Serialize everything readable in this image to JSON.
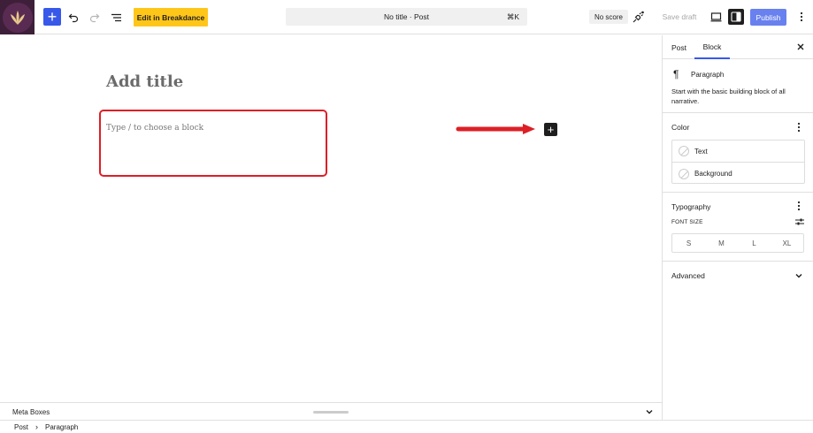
{
  "topbar": {
    "breakdance_label": "Edit in Breakdance",
    "command": {
      "title": "No title · Post",
      "shortcut": "⌘K"
    },
    "score_label": "No score",
    "save_draft_label": "Save draft",
    "publish_label": "Publish"
  },
  "editor": {
    "title_placeholder": "Add title",
    "paragraph_placeholder": "Type / to choose a block"
  },
  "sidebar": {
    "tabs": [
      {
        "label": "Post"
      },
      {
        "label": "Block"
      }
    ],
    "block_card": {
      "name": "Paragraph",
      "description": "Start with the basic building block of all narrative."
    },
    "color": {
      "title": "Color",
      "items": [
        {
          "label": "Text"
        },
        {
          "label": "Background"
        }
      ]
    },
    "typography": {
      "title": "Typography",
      "font_size_label": "FONT SIZE",
      "sizes": [
        "S",
        "M",
        "L",
        "XL"
      ]
    },
    "advanced": {
      "title": "Advanced"
    }
  },
  "metaboxes": {
    "label": "Meta Boxes"
  },
  "breadcrumb": {
    "items": [
      "Post",
      "Paragraph"
    ]
  },
  "colors": {
    "accent": "#3858e9",
    "breakdance": "#ffc61a",
    "annotation_red": "#dd1f26",
    "logo_bg": "#3d1f3a"
  }
}
